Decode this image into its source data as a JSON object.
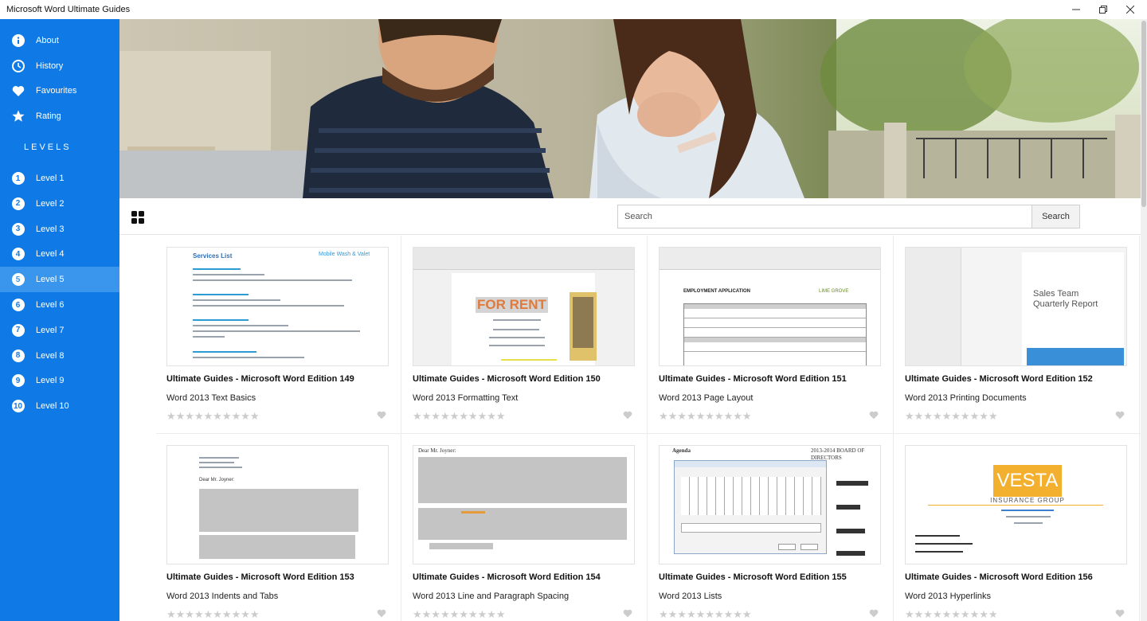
{
  "window": {
    "title": "Microsoft Word Ultimate Guides"
  },
  "sidebar": {
    "menu": [
      {
        "label": "About",
        "icon": "info-icon"
      },
      {
        "label": "History",
        "icon": "clock-icon"
      },
      {
        "label": "Favourites",
        "icon": "heart-icon"
      },
      {
        "label": "Rating",
        "icon": "star-icon"
      }
    ],
    "levels_heading": "LEVELS",
    "levels": [
      {
        "num": "1",
        "label": "Level 1"
      },
      {
        "num": "2",
        "label": "Level 2"
      },
      {
        "num": "3",
        "label": "Level 3"
      },
      {
        "num": "4",
        "label": "Level 4"
      },
      {
        "num": "5",
        "label": "Level 5"
      },
      {
        "num": "6",
        "label": "Level 6"
      },
      {
        "num": "7",
        "label": "Level 7"
      },
      {
        "num": "8",
        "label": "Level 8"
      },
      {
        "num": "9",
        "label": "Level 9"
      },
      {
        "num": "10",
        "label": "Level 10"
      }
    ],
    "active_level": "Level 5"
  },
  "search": {
    "placeholder": "Search",
    "button_label": "Search"
  },
  "cards": [
    {
      "title": "Ultimate Guides - Microsoft Word Edition 149",
      "subtitle": "Word 2013 Text Basics",
      "rating": 0,
      "thumb_heading": "Services List",
      "thumb_logo": "Mobile Wash & Valet"
    },
    {
      "title": "Ultimate Guides - Microsoft Word Edition 150",
      "subtitle": "Word 2013 Formatting Text",
      "rating": 0,
      "thumb_heading": "FOR RENT"
    },
    {
      "title": "Ultimate Guides - Microsoft Word Edition 151",
      "subtitle": "Word 2013 Page Layout",
      "rating": 0,
      "thumb_heading": "EMPLOYMENT APPLICATION",
      "thumb_logo": "LIME GROVE"
    },
    {
      "title": "Ultimate Guides - Microsoft Word Edition 152",
      "subtitle": "Word 2013 Printing Documents",
      "rating": 0,
      "thumb_heading": "Sales Team Quarterly Report"
    },
    {
      "title": "Ultimate Guides - Microsoft Word Edition 153",
      "subtitle": "Word 2013 Indents and Tabs",
      "rating": 0,
      "thumb_heading": "Dear Mr. Joyner:"
    },
    {
      "title": "Ultimate Guides - Microsoft Word Edition 154",
      "subtitle": "Word 2013 Line and Paragraph Spacing",
      "rating": 0,
      "thumb_heading": "Dear Mr. Joyner:"
    },
    {
      "title": "Ultimate Guides - Microsoft Word Edition 155",
      "subtitle": "Word 2013 Lists",
      "rating": 0,
      "thumb_heading": "Agenda",
      "thumb_logo": "2013-2014 BOARD OF DIRECTORS"
    },
    {
      "title": "Ultimate Guides - Microsoft Word Edition 156",
      "subtitle": "Word 2013 Hyperlinks",
      "rating": 0,
      "thumb_heading": "VESTA",
      "thumb_logo": "INSURANCE GROUP"
    }
  ],
  "colors": {
    "sidebar": "#0f7ae5",
    "sidebar_active": "#3a95ec",
    "star_empty": "#cccccc"
  }
}
